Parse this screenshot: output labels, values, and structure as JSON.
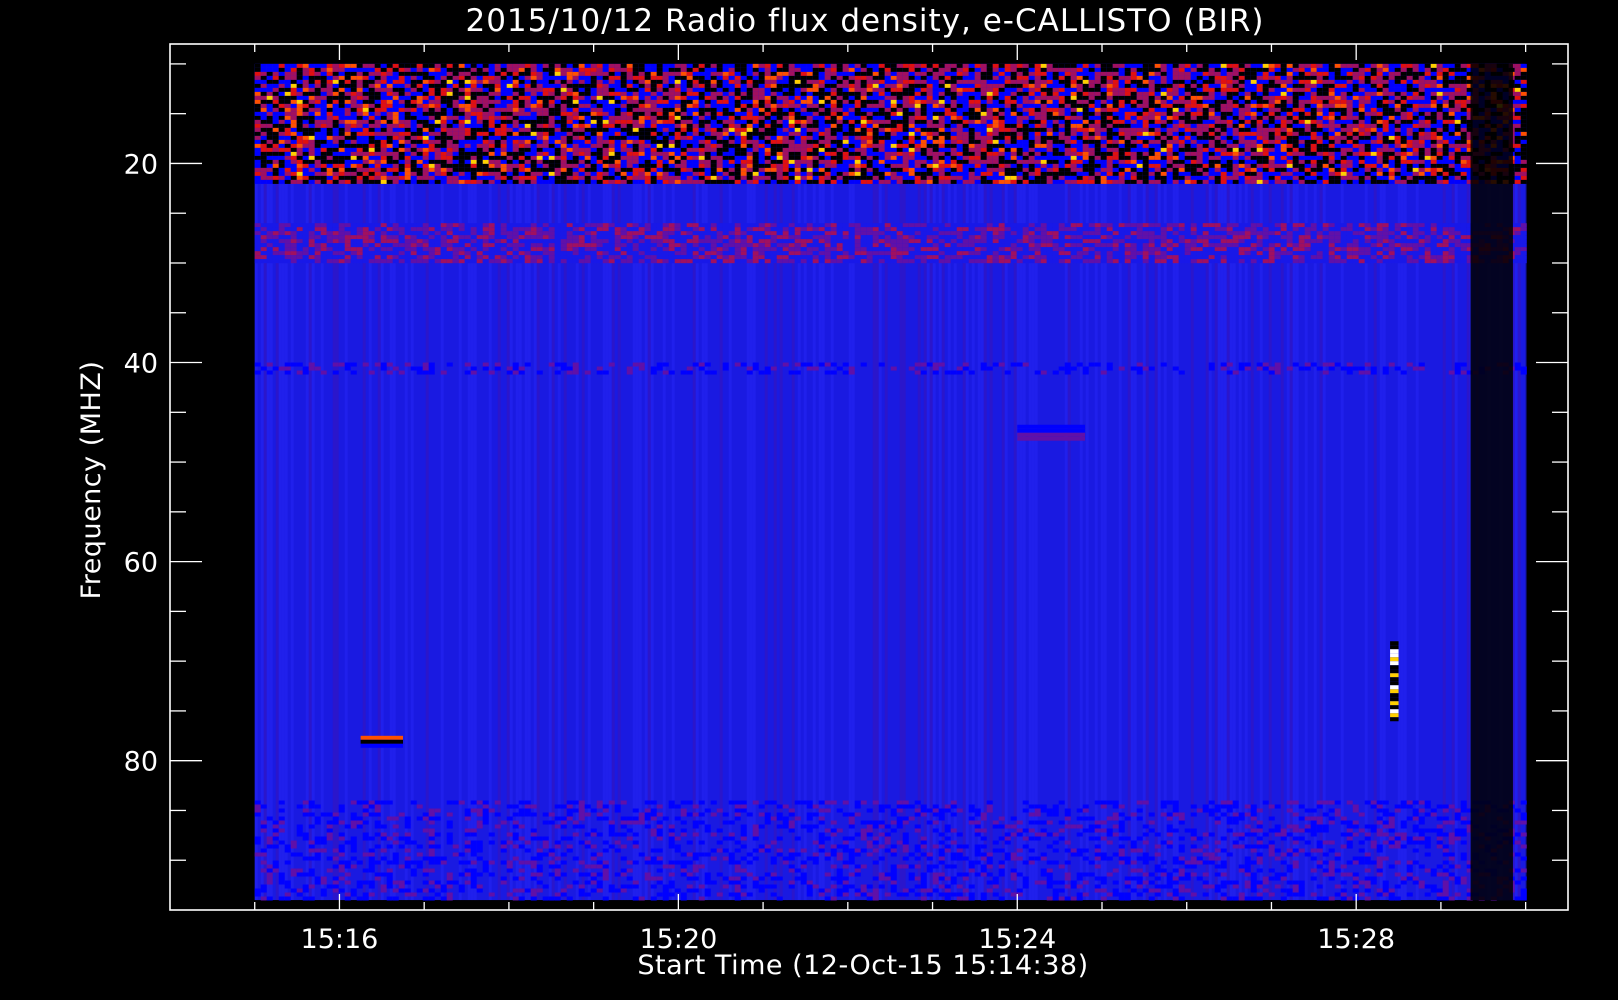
{
  "chart_data": {
    "type": "heatmap",
    "title": "2015/10/12  Radio flux density, e-CALLISTO (BIR)",
    "xlabel": "Start Time (12-Oct-15 15:14:38)",
    "ylabel": "Frequency (MHZ)",
    "x_unit": "minutes after 15:00 UT",
    "xlim": [
      14.0,
      30.5
    ],
    "ylim": [
      95,
      8
    ],
    "y_inverted": true,
    "x_major_ticks": [
      16,
      20,
      24,
      28
    ],
    "x_minor_ticks": [
      15,
      17,
      18,
      19,
      21,
      22,
      23,
      25,
      26,
      27,
      29,
      30
    ],
    "x_tick_labels": [
      "15:16",
      "15:20",
      "15:24",
      "15:28"
    ],
    "y_major_ticks": [
      20,
      40,
      60,
      80
    ],
    "y_minor_ticks": [
      10,
      15,
      25,
      30,
      35,
      45,
      50,
      55,
      65,
      70,
      75,
      85,
      90
    ],
    "y_tick_labels": [
      "20",
      "40",
      "60",
      "80"
    ],
    "data_extent": {
      "t_start": 15.0,
      "t_end": 30.0,
      "f_min": 10,
      "f_max": 94
    },
    "colormap": [
      "#000000",
      "#0000ff",
      "#1818e8",
      "#6010a8",
      "#a01060",
      "#e01010",
      "#ff5000",
      "#ffd000",
      "#ffffff"
    ],
    "background_color": "#1a1ae6",
    "bands": [
      {
        "f1": 10,
        "f2": 22,
        "level": "high",
        "note": "strong RFI / noise band"
      },
      {
        "f1": 26,
        "f2": 30,
        "level": "medium"
      },
      {
        "f1": 40,
        "f2": 41,
        "level": "low"
      },
      {
        "f1": 84,
        "f2": 94,
        "level": "low"
      }
    ],
    "features": [
      {
        "t": 16.5,
        "f": 78.0,
        "dt": 0.5,
        "df": 1.0,
        "level": "high"
      },
      {
        "t": 24.4,
        "f": 47.0,
        "dt": 0.8,
        "df": 1.5,
        "level": "low"
      },
      {
        "t": 28.45,
        "f": 72.0,
        "dt": 0.1,
        "df": 8.0,
        "level": "max"
      },
      {
        "t": 29.6,
        "f": 52.0,
        "dt": 0.5,
        "df": 84.0,
        "level": "none",
        "note": "dark vertical stripe"
      }
    ]
  }
}
